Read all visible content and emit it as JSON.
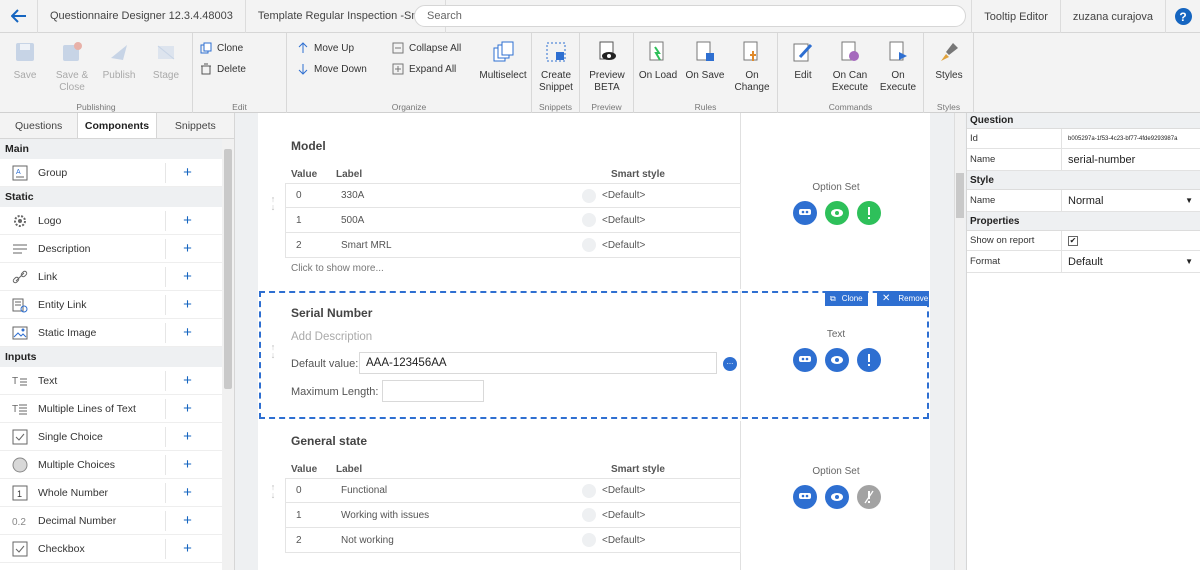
{
  "topbar": {
    "app_version": "Questionnaire Designer 12.3.4.48003",
    "template_name": "Template Regular Inspection -Smart",
    "search_placeholder": "Search",
    "tooltip_editor": "Tooltip Editor",
    "user": "zuzana curajova",
    "help": "?"
  },
  "ribbon": {
    "publishing": {
      "label": "Publishing",
      "save": "Save",
      "save_close": "Save & Close",
      "publish": "Publish",
      "stage": "Stage"
    },
    "edit": {
      "label": "Edit",
      "clone": "Clone",
      "delete": "Delete"
    },
    "organize": {
      "label": "Organize",
      "move_up": "Move Up",
      "move_down": "Move Down",
      "collapse_all": "Collapse All",
      "expand_all": "Expand All",
      "multiselect": "Multiselect"
    },
    "snippets": {
      "label": "Snippets",
      "create_snippet": "Create Snippet"
    },
    "preview": {
      "label": "Preview",
      "preview_beta": "Preview BETA"
    },
    "rules": {
      "label": "Rules",
      "on_load": "On Load",
      "on_save": "On Save",
      "on_change": "On Change"
    },
    "commands": {
      "label": "Commands",
      "edit": "Edit",
      "on_can_execute": "On Can Execute",
      "on_execute": "On Execute"
    },
    "styles": {
      "label": "Styles",
      "styles": "Styles"
    }
  },
  "left_panel": {
    "tabs": [
      "Questions",
      "Components",
      "Snippets"
    ],
    "active_tab": "Components",
    "sections": [
      {
        "title": "Main",
        "items": [
          {
            "label": "Group",
            "icon": "group-icon"
          }
        ]
      },
      {
        "title": "Static",
        "items": [
          {
            "label": "Logo",
            "icon": "logo-gear-icon"
          },
          {
            "label": "Description",
            "icon": "description-lines-icon"
          },
          {
            "label": "Link",
            "icon": "link-icon"
          },
          {
            "label": "Entity Link",
            "icon": "entity-link-icon"
          },
          {
            "label": "Static Image",
            "icon": "image-icon"
          }
        ]
      },
      {
        "title": "Inputs",
        "items": [
          {
            "label": "Text",
            "icon": "text-icon"
          },
          {
            "label": "Multiple Lines of Text",
            "icon": "multiline-icon"
          },
          {
            "label": "Single Choice",
            "icon": "single-choice-icon"
          },
          {
            "label": "Multiple Choices",
            "icon": "multiple-choices-icon"
          },
          {
            "label": "Whole Number",
            "icon": "whole-number-icon"
          },
          {
            "label": "Decimal Number",
            "icon": "decimal-number-icon"
          },
          {
            "label": "Checkbox",
            "icon": "checkbox-icon"
          }
        ]
      }
    ],
    "add": "+"
  },
  "canvas": {
    "columns": {
      "value": "Value",
      "label": "Label",
      "smart_style": "Smart style"
    },
    "model": {
      "title": "Model",
      "type": "Option Set",
      "rows": [
        {
          "value": "0",
          "label": "330A",
          "style": "<Default>"
        },
        {
          "value": "1",
          "label": "500A",
          "style": "<Default>"
        },
        {
          "value": "2",
          "label": "Smart MRL",
          "style": "<Default>"
        }
      ],
      "more": "Click to show more..."
    },
    "serial": {
      "title": "Serial Number",
      "description_placeholder": "Add Description",
      "default_label": "Default value:",
      "default_value": "AAA-123456AA",
      "max_length_label": "Maximum Length:",
      "max_length_value": "",
      "type": "Text",
      "clone": "Clone",
      "remove": "Remove"
    },
    "general": {
      "title": "General state",
      "type": "Option Set",
      "rows": [
        {
          "value": "0",
          "label": "Functional",
          "style": "<Default>"
        },
        {
          "value": "1",
          "label": "Working with issues",
          "style": "<Default>"
        },
        {
          "value": "2",
          "label": "Not working",
          "style": "<Default>"
        }
      ]
    }
  },
  "properties": {
    "question_header": "Question",
    "id_label": "Id",
    "id_value": "b005297a-1f53-4c23-bf77-4fde9293987a",
    "name_label": "Name",
    "name_value": "serial-number",
    "style_header": "Style",
    "style_name_label": "Name",
    "style_name_value": "Normal",
    "props_header": "Properties",
    "show_on_report_label": "Show on report",
    "show_on_report_checked": "✔",
    "format_label": "Format",
    "format_value": "Default"
  },
  "colors": {
    "accent": "#2e6fd1",
    "green": "#2ec05a",
    "disabled": "#a3a3a3"
  }
}
